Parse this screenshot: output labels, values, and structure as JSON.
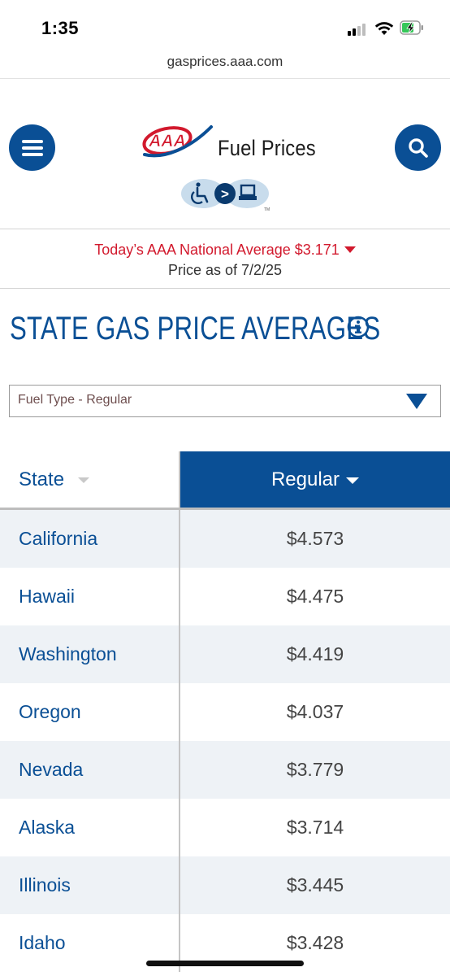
{
  "status_bar": {
    "time": "1:35"
  },
  "browser": {
    "url": "gasprices.aaa.com"
  },
  "header": {
    "logo_text": "AAA",
    "title": "Fuel Prices",
    "menu_icon": "hamburger-icon",
    "search_icon": "search-icon",
    "accessibility_icon": "wheelchair-to-computer-icon"
  },
  "national": {
    "line": "Today’s AAA National Average $3.171",
    "trend": "down",
    "price_as_of": "Price as of 7/2/25"
  },
  "section": {
    "title": "STATE GAS PRICE AVERAGES"
  },
  "fuel_select": {
    "value": "Fuel Type - Regular"
  },
  "table": {
    "columns": [
      "State",
      "Regular"
    ],
    "rows": [
      {
        "state": "California",
        "price": "$4.573"
      },
      {
        "state": "Hawaii",
        "price": "$4.475"
      },
      {
        "state": "Washington",
        "price": "$4.419"
      },
      {
        "state": "Oregon",
        "price": "$4.037"
      },
      {
        "state": "Nevada",
        "price": "$3.779"
      },
      {
        "state": "Alaska",
        "price": "$3.714"
      },
      {
        "state": "Illinois",
        "price": "$3.445"
      },
      {
        "state": "Idaho",
        "price": "$3.428"
      }
    ]
  },
  "colors": {
    "brand_blue": "#0a4f95",
    "alert_red": "#d2192d",
    "row_alt": "#eef2f6"
  }
}
